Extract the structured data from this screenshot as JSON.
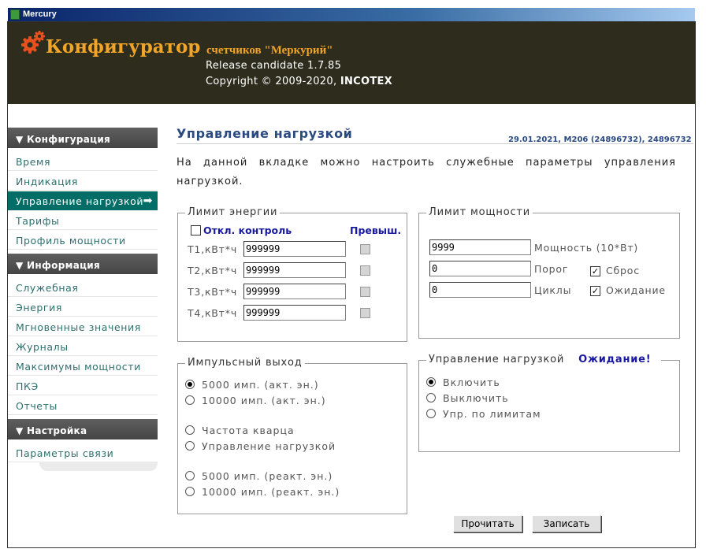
{
  "window": {
    "title": "Mercury"
  },
  "header": {
    "app_title": "Конфигуратор",
    "app_subtitle": "счетчиков \"Меркурий\"",
    "release": "Release candidate 1.7.85",
    "copyright_prefix": "Copyright © 2009-2020, ",
    "copyright_company": "INCOTEX"
  },
  "sidebar": {
    "sections": [
      {
        "title": "▼ Конфигурация",
        "items": [
          "Время",
          "Индикация",
          "Управление нагрузкой",
          "Тарифы",
          "Профиль мощности"
        ]
      },
      {
        "title": "▼ Информация",
        "items": [
          "Служебная",
          "Энергия",
          "Мгновенные значения",
          "Журналы",
          "Максимумы мощности",
          "ПКЭ",
          "Отчеты"
        ]
      },
      {
        "title": "▼ Настройка",
        "items": [
          "Параметры связи"
        ]
      }
    ],
    "active_item": "Управление нагрузкой",
    "active_arrow": "➡"
  },
  "main": {
    "title": "Управление нагрузкой",
    "meter_info": "29.01.2021, M206 (24896732), 24896732",
    "description": "На данной вкладке можно настроить служебные параметры управления нагрузкой."
  },
  "energy_limit": {
    "legend": "Лимит энергии",
    "disable_control_label": "Откл. контроль",
    "disable_control_checked": false,
    "exceeded_label": "Превыш.",
    "rows": [
      {
        "label": "T1,кВт*ч",
        "value": "999999"
      },
      {
        "label": "T2,кВт*ч",
        "value": "999999"
      },
      {
        "label": "T3,кВт*ч",
        "value": "999999"
      },
      {
        "label": "T4,кВт*ч",
        "value": "999999"
      }
    ]
  },
  "power_limit": {
    "legend": "Лимит мощности",
    "power_value": "9999",
    "power_label": "Мощность (10*Вт)",
    "threshold_value": "0",
    "threshold_label": "Порог",
    "cycles_value": "0",
    "cycles_label": "Циклы",
    "reset_label": "Сброс",
    "reset_checked": true,
    "wait_label": "Ожидание",
    "wait_checked": true
  },
  "pulse_output": {
    "legend": "Импульсный выход",
    "options": [
      "5000 имп. (акт. эн.)",
      "10000 имп. (акт. эн.)",
      "Частота кварца",
      "Управление нагрузкой",
      "5000 имп. (реакт. эн.)",
      "10000 имп. (реакт. эн.)"
    ],
    "selected": "5000 имп. (акт. эн.)"
  },
  "load_control": {
    "legend": "Управление нагрузкой",
    "status": "Ожидание!",
    "status_color": "#1a1aa0",
    "options": [
      "Включить",
      "Выключить",
      "Упр. по лимитам"
    ],
    "selected": "Включить"
  },
  "buttons": {
    "read": "Прочитать",
    "write": "Записать"
  },
  "colors": {
    "header_bg": "#2e2c1d",
    "accent_orange": "#f0a528",
    "active_item_bg": "#006e66",
    "title_blue": "#2a4a80"
  }
}
